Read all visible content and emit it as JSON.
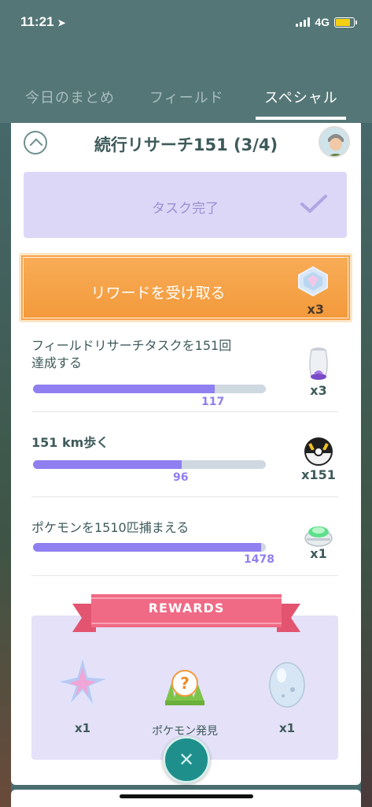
{
  "status_bar": {
    "time": "11:21",
    "network": "4G",
    "battery_color": "#f4cf14"
  },
  "tabs": [
    {
      "label": "今日のまとめ",
      "active": false
    },
    {
      "label": "フィールド",
      "active": false
    },
    {
      "label": "スペシャル",
      "active": true
    }
  ],
  "research": {
    "title": "続行リサーチ151 (3/4)",
    "task_done_label": "タスク完了",
    "claim_button": {
      "label": "リワードを受け取る",
      "qty": "x3",
      "icon": "mystic-gem-icon"
    },
    "tasks": [
      {
        "text_line1": "フィールドリサーチタスクを151回",
        "text_line2": "達成する",
        "progress": 0.78,
        "count": "117",
        "reward_icon": "incense-icon",
        "reward_qty": "x3"
      },
      {
        "text_line1": "151 km歩く",
        "text_line2": "",
        "progress": 0.64,
        "count": "96",
        "reward_icon": "ultra-ball-icon",
        "reward_qty": "x151"
      },
      {
        "text_line1": "ポケモンを1510匹捕まえる",
        "text_line2": "",
        "progress": 0.98,
        "count": "1478",
        "reward_icon": "lure-module-icon",
        "reward_qty": "x1"
      }
    ]
  },
  "rewards": {
    "banner": "REWARDS",
    "items": [
      {
        "icon": "star-piece-icon",
        "caption": "x1"
      },
      {
        "icon": "mystery-pokemon-icon",
        "caption": "ポケモン発見"
      },
      {
        "icon": "egg-icon",
        "caption": "x1"
      }
    ]
  },
  "colors": {
    "header_bg": "#557676",
    "progress_fill": "#8f7ff0",
    "claim_button": "#f6a14a",
    "task_done_bg": "#ddd7f7",
    "rewards_bg": "#e4e1f8",
    "ribbon": "#f06a85",
    "close_button": "#1f8f8c"
  }
}
